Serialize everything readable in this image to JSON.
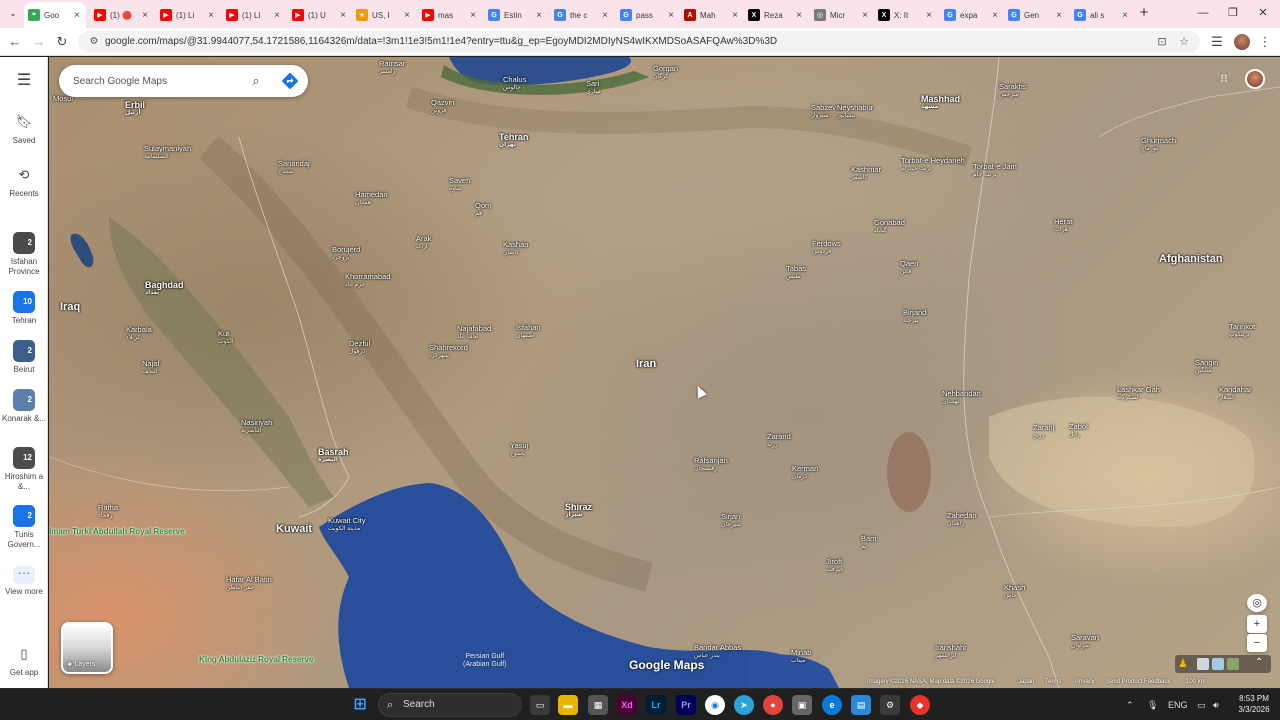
{
  "browser": {
    "tabs": [
      {
        "title": "Goo",
        "favicon": "google-maps-icon",
        "active": true
      },
      {
        "title": "(1) 🔴",
        "favicon": "youtube-icon"
      },
      {
        "title": "(1) Li",
        "favicon": "youtube-icon"
      },
      {
        "title": "(1) Ll",
        "favicon": "youtube-icon"
      },
      {
        "title": "(1) U",
        "favicon": "youtube-icon"
      },
      {
        "title": "US, I",
        "favicon": "news-icon"
      },
      {
        "title": "mas",
        "favicon": "youtube-icon"
      },
      {
        "title": "Estin",
        "favicon": "google-icon"
      },
      {
        "title": "the c",
        "favicon": "google-icon"
      },
      {
        "title": "pass",
        "favicon": "google-icon"
      },
      {
        "title": "Mah",
        "favicon": "pdf-icon"
      },
      {
        "title": "Reza",
        "favicon": "x-icon"
      },
      {
        "title": "Micr",
        "favicon": "web-icon"
      },
      {
        "title": "X: It",
        "favicon": "x-icon"
      },
      {
        "title": "expa",
        "favicon": "google-icon"
      },
      {
        "title": "Gen",
        "favicon": "google-icon"
      },
      {
        "title": "ali s",
        "favicon": "google-icon"
      }
    ],
    "url": "google.com/maps/@31.9944077,54.1721586,1164326m/data=!3m1!1e3!5m1!1e4?entry=ttu&g_ep=EgoyMDI2MDIyNS4wIKXMDSoASAFQAw%3D%3D"
  },
  "maps": {
    "search_placeholder": "Search Google Maps",
    "rail": {
      "saved": "Saved",
      "recents": "Recents",
      "recent_places": [
        {
          "label": "Isfahan Province",
          "count": "2",
          "color": "#4a4a4a"
        },
        {
          "label": "Tehran",
          "count": "10",
          "color": "#1a73e8"
        },
        {
          "label": "Beirut",
          "count": "2",
          "color": "#3b5f8a"
        },
        {
          "label": "Konarak &...",
          "count": "2",
          "color": "#5a7fa8"
        },
        {
          "label": "Hiroshim a &...",
          "count": "12",
          "color": "#4d4d4d"
        },
        {
          "label": "Tunis Govern...",
          "count": "2",
          "color": "#1a73e8"
        }
      ],
      "view_more": "View more",
      "get_app": "Get app"
    },
    "layers_label": "Layers",
    "logo": "Google Maps",
    "attribution": {
      "imagery": "Imagery ©2026 NASA, Map data ©2026 Google",
      "japan": "Japan",
      "terms": "Terms",
      "privacy": "Privacy",
      "feedback": "Send Product Feedback",
      "scale": "100 km"
    },
    "labels": {
      "countries": {
        "iran": "Iran",
        "iraq": "Iraq",
        "afghanistan": "Afghanistan",
        "kuwait": "Kuwait"
      },
      "cities": [
        {
          "name": "Ramsar",
          "sub": "رامسر"
        },
        {
          "name": "Chalus",
          "sub": "چالوس"
        },
        {
          "name": "Sari",
          "sub": "ساری"
        },
        {
          "name": "Gorgan",
          "sub": "گرگان"
        },
        {
          "name": "Mashhad",
          "sub": "مشهد"
        },
        {
          "name": "Sarakhs",
          "sub": "سرخس"
        },
        {
          "name": "Mosul",
          "sub": ""
        },
        {
          "name": "Erbil",
          "sub": "أربيل"
        },
        {
          "name": "Qazvin",
          "sub": "قزوین"
        },
        {
          "name": "Tehran",
          "sub": "تهران"
        },
        {
          "name": "Sabzevar",
          "sub": "سبزوار"
        },
        {
          "name": "Neyshabur",
          "sub": "نیشابور"
        },
        {
          "name": "Sulaymaniyah",
          "sub": "السليمانية"
        },
        {
          "name": "Sanandaj",
          "sub": "سنندج"
        },
        {
          "name": "Saveh",
          "sub": "ساوه"
        },
        {
          "name": "Qom",
          "sub": "قم"
        },
        {
          "name": "Kashmar",
          "sub": "کاشمر"
        },
        {
          "name": "Torbat-e Heydarieh",
          "sub": "تربت حیدریه"
        },
        {
          "name": "Torbat-e Jam",
          "sub": "تربت جام"
        },
        {
          "name": "Ghurmach",
          "sub": "غورماچ"
        },
        {
          "name": "Hamedan",
          "sub": "همدان"
        },
        {
          "name": "Arak",
          "sub": "اراک"
        },
        {
          "name": "Kashan",
          "sub": "کاشان"
        },
        {
          "name": "Gonabad",
          "sub": "گناباد"
        },
        {
          "name": "Herat",
          "sub": "هرات"
        },
        {
          "name": "Borujerd",
          "sub": "بروجرد"
        },
        {
          "name": "Ferdows",
          "sub": "فردوس"
        },
        {
          "name": "Tabas",
          "sub": "طبس"
        },
        {
          "name": "Qaen",
          "sub": "قائن"
        },
        {
          "name": "Baghdad",
          "sub": "بغداد"
        },
        {
          "name": "Khorramabad",
          "sub": "خرم آباد"
        },
        {
          "name": "Birjand",
          "sub": "بیرجند"
        },
        {
          "name": "Tarinkot",
          "sub": "ترینکوټ"
        },
        {
          "name": "Karbala",
          "sub": "كربلاء"
        },
        {
          "name": "Najafabad",
          "sub": "نجف آباد"
        },
        {
          "name": "Isfahan",
          "sub": "اصفهان"
        },
        {
          "name": "Kut",
          "sub": "الكوت"
        },
        {
          "name": "Dezful",
          "sub": "دزفول"
        },
        {
          "name": "Shahrekord",
          "sub": "شهرکرد"
        },
        {
          "name": "Sangin",
          "sub": "سنگين"
        },
        {
          "name": "Najaf",
          "sub": "النجف"
        },
        {
          "name": "Lashkar Gah",
          "sub": "لشکرگاه"
        },
        {
          "name": "Kandahar",
          "sub": "کندهار"
        },
        {
          "name": "Nehbandan",
          "sub": "نهبندان"
        },
        {
          "name": "Nasiriyah",
          "sub": "الناصرية"
        },
        {
          "name": "Zabol",
          "sub": "زابل"
        },
        {
          "name": "Zaranj",
          "sub": "زرنج"
        },
        {
          "name": "Zarand",
          "sub": "زرند"
        },
        {
          "name": "Yasuj",
          "sub": "یاسوج"
        },
        {
          "name": "Basrah",
          "sub": "البصرة"
        },
        {
          "name": "Rafsanjan",
          "sub": "رفسنجان"
        },
        {
          "name": "Kerman",
          "sub": "کرمان"
        },
        {
          "name": "Rafha",
          "sub": "رفحاء"
        },
        {
          "name": "Shiraz",
          "sub": "شیراز"
        },
        {
          "name": "Zahedan",
          "sub": "زاهدان"
        },
        {
          "name": "Kuwait City",
          "sub": "مدينة الكويت"
        },
        {
          "name": "Sirjan",
          "sub": "سیرجان"
        },
        {
          "name": "Bam",
          "sub": "بم"
        },
        {
          "name": "Jiroft",
          "sub": "جیرفت"
        },
        {
          "name": "Hafar Al Batin",
          "sub": "حفر الباطن"
        },
        {
          "name": "Khash",
          "sub": "خاش"
        },
        {
          "name": "Saravan",
          "sub": "سراوان"
        },
        {
          "name": "Bandar Abbas",
          "sub": "بندر عباس"
        },
        {
          "name": "Minab",
          "sub": "میناب"
        },
        {
          "name": "Iranshahr",
          "sub": "ایرانشهر"
        }
      ],
      "reserves": {
        "turki": "Imam Turki Abdullah Royal Reserve",
        "king": "King Abdulaziz Royal Reserve"
      },
      "gulf": {
        "line1": "Persian Gulf",
        "line2": "(Arabian Gulf)"
      }
    }
  },
  "taskbar": {
    "search": "Search",
    "lang": "ENG",
    "time": "8:53 PM",
    "date": "3/3/2026"
  }
}
